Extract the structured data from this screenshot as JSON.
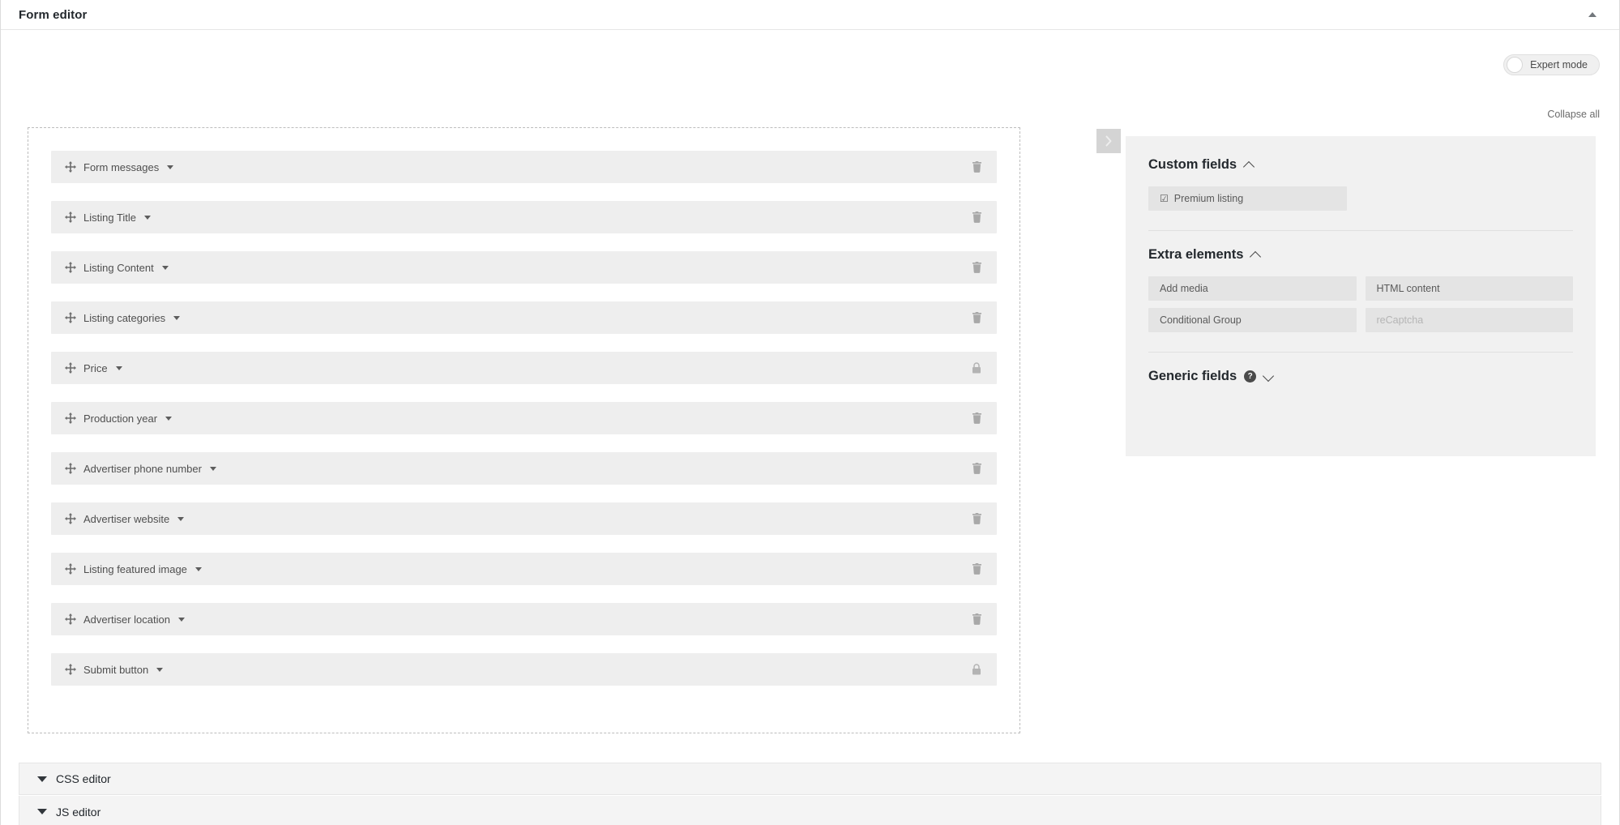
{
  "titlebar": {
    "title": "Form editor",
    "collapse_icon": "caret-up-icon"
  },
  "toolbar": {
    "expert_mode_label": "Expert mode",
    "expert_mode_on": false,
    "collapse_all_label": "Collapse all"
  },
  "form_canvas": {
    "fields": [
      {
        "label": "Form messages",
        "action": "trash-icon",
        "locked": false
      },
      {
        "label": "Listing Title",
        "action": "trash-icon",
        "locked": false
      },
      {
        "label": "Listing Content",
        "action": "trash-icon",
        "locked": false
      },
      {
        "label": "Listing categories",
        "action": "trash-icon",
        "locked": false
      },
      {
        "label": "Price",
        "action": "lock-icon",
        "locked": true
      },
      {
        "label": "Production year",
        "action": "trash-icon",
        "locked": false
      },
      {
        "label": "Advertiser phone number",
        "action": "trash-icon",
        "locked": false
      },
      {
        "label": "Advertiser website",
        "action": "trash-icon",
        "locked": false
      },
      {
        "label": "Listing featured image",
        "action": "trash-icon",
        "locked": false
      },
      {
        "label": "Advertiser location",
        "action": "trash-icon",
        "locked": false
      },
      {
        "label": "Submit button",
        "action": "lock-icon",
        "locked": true
      }
    ]
  },
  "panel_toggle": {
    "icon": "chevron-right-icon"
  },
  "sidebar": {
    "sections": [
      {
        "title": "Custom fields",
        "expanded": true,
        "chevron": "chevron-up-icon",
        "items": [
          {
            "label": "Premium listing",
            "icon": "checkbox-icon",
            "disabled": false
          }
        ]
      },
      {
        "title": "Extra elements",
        "expanded": true,
        "chevron": "chevron-up-icon",
        "items": [
          {
            "label": "Add media",
            "disabled": false
          },
          {
            "label": "HTML content",
            "disabled": false
          },
          {
            "label": "Conditional Group",
            "disabled": false
          },
          {
            "label": "reCaptcha",
            "disabled": true
          }
        ]
      },
      {
        "title": "Generic fields",
        "expanded": false,
        "chevron": "chevron-down-icon",
        "help_icon": "help-icon",
        "help_glyph": "?",
        "items": []
      }
    ]
  },
  "bottom_editors": [
    {
      "label": "CSS editor",
      "icon": "triangle-down-icon"
    },
    {
      "label": "JS editor",
      "icon": "triangle-down-icon"
    }
  ],
  "colors": {
    "page_bg": "#ffffff",
    "row_bg": "#eeeeee",
    "sidebar_bg": "#f1f1f1",
    "chip_bg": "#e4e4e4",
    "text_primary": "#23282d",
    "text_secondary": "#4f4f4f",
    "text_muted": "#b5b5b5"
  }
}
